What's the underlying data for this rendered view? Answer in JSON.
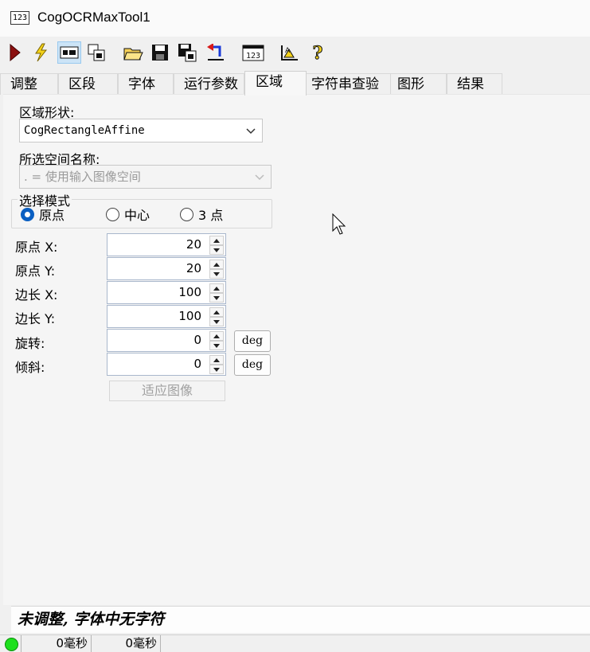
{
  "window": {
    "title": "CogOCRMaxTool1",
    "icon_text": "123"
  },
  "toolbar": {
    "buttons": [
      "run-icon",
      "electric-run-icon",
      "show-image-icon",
      "copy-image-icon",
      "open-icon",
      "save-icon",
      "save-as-icon",
      "reset-icon",
      "font-123-icon",
      "train-icon",
      "help-icon"
    ],
    "font_icon_text": "123"
  },
  "tabs": [
    "调整",
    "区段",
    "字体",
    "运行参数",
    "区域",
    "字符串查验",
    "图形",
    "结果"
  ],
  "selected_tab": "区域",
  "region": {
    "shape_label": "区域形状:",
    "shape_value": "CogRectangleAffine",
    "space_label": "所选空间名称:",
    "space_value": ". = 使用输入图像空间",
    "mode_label": "选择模式",
    "modes": [
      "原点",
      "中心",
      "3 点"
    ],
    "selected_mode": "原点"
  },
  "fields": [
    {
      "label": "原点 X:",
      "value": "20"
    },
    {
      "label": "原点 Y:",
      "value": "20"
    },
    {
      "label": "边长 X:",
      "value": "100"
    },
    {
      "label": "边长 Y:",
      "value": "100"
    },
    {
      "label": "旋转:",
      "value": "0",
      "unit": "deg"
    },
    {
      "label": "倾斜:",
      "value": "0",
      "unit": "deg"
    }
  ],
  "fit_button": "适应图像",
  "status_message": "未调整, 字体中无字符",
  "statusbar": {
    "time1": "0毫秒",
    "time2": "0毫秒",
    "led_color": "#1ee01e"
  }
}
